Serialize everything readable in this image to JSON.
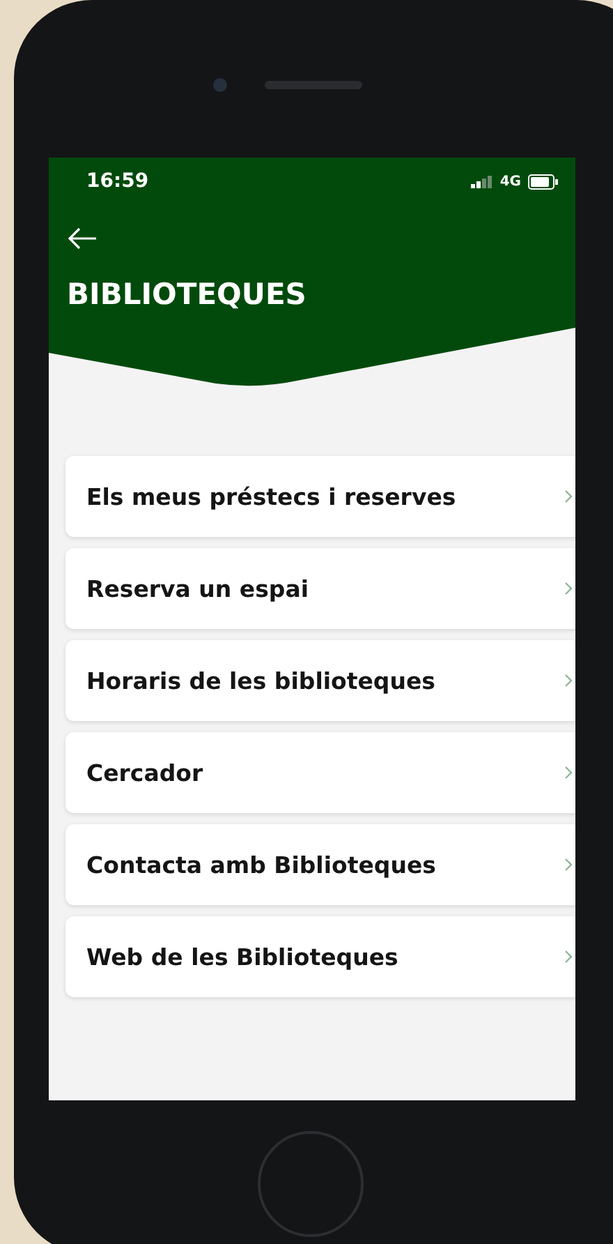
{
  "status_bar": {
    "time": "16:59",
    "network": "4G"
  },
  "header": {
    "title": "BIBLIOTEQUES"
  },
  "menu": [
    {
      "label": "Els meus préstecs i reserves"
    },
    {
      "label": "Reserva un espai"
    },
    {
      "label": "Horaris de les biblioteques"
    },
    {
      "label": "Cercador"
    },
    {
      "label": "Contacta amb Biblioteques"
    },
    {
      "label": "Web de les Biblioteques"
    }
  ]
}
